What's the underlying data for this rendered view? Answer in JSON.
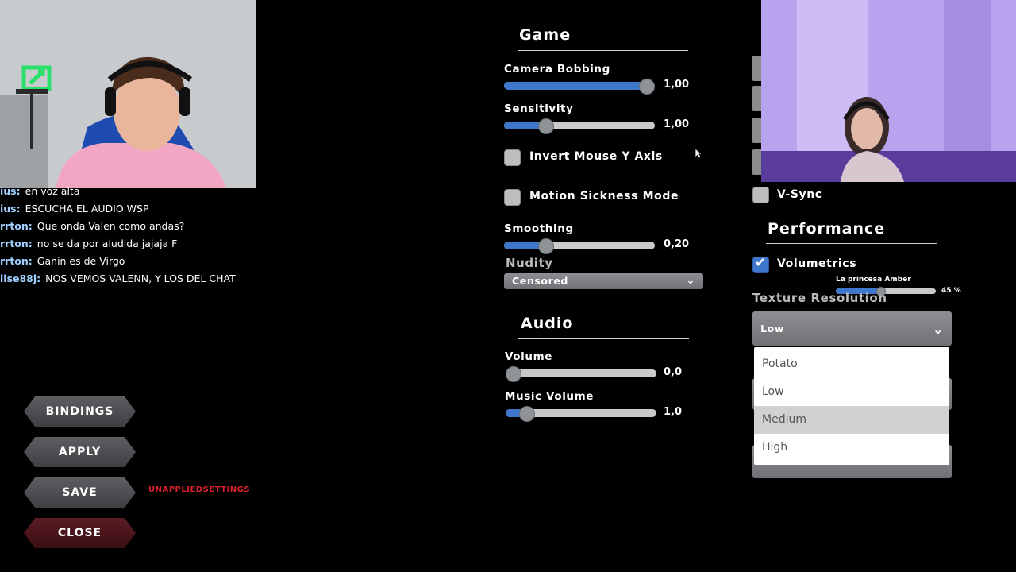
{
  "chat": [
    {
      "user": "ius:",
      "message": "en voz alta"
    },
    {
      "user": "ius:",
      "message": "ESCUCHA EL AUDIO WSP"
    },
    {
      "user": "rrton:",
      "message": "Que onda Valen como andas?"
    },
    {
      "user": "rrton:",
      "message": "no se da por aludida jajaja F"
    },
    {
      "user": "rrton:",
      "message": "Ganin es de Virgo"
    },
    {
      "user": "lise88j:",
      "message": "NOS VEMOS VALENN, Y LOS DEL CHAT"
    }
  ],
  "game": {
    "title": "Game",
    "camera_bobbing": {
      "label": "Camera Bobbing",
      "value_text": "1,00",
      "level": 1.0
    },
    "sensitivity": {
      "label": "Sensitivity",
      "value_text": "1,00",
      "level": 0.25
    },
    "invert_mouse": {
      "label": "Invert Mouse Y Axis",
      "checked": false
    },
    "motion_sickness": {
      "label": "Motion Sickness Mode",
      "checked": false
    },
    "smoothing": {
      "label": "Smoothing",
      "value_text": "0,20",
      "level": 0.25
    },
    "nudity": {
      "label": "Nudity",
      "selected": "Censored"
    }
  },
  "audio": {
    "title": "Audio",
    "volume": {
      "label": "Volume",
      "value_text": "0,0",
      "level": 0.0
    },
    "music_volume": {
      "label": "Music Volume",
      "value_text": "1,0",
      "level": 0.1
    }
  },
  "right": {
    "vsync": {
      "label": "V-Sync",
      "checked": false
    },
    "performance_title": "Performance",
    "volumetrics": {
      "label": "Volumetrics",
      "checked": true
    },
    "goal_overlay": {
      "label": "La princesa Amber",
      "percent_text": "45 %",
      "level": 0.45
    },
    "texture_resolution": {
      "label": "Texture Resolution",
      "selected": "Low",
      "options": [
        "Potato",
        "Low",
        "Medium",
        "High"
      ],
      "highlighted": "Medium"
    }
  },
  "buttons": {
    "bindings": "BINDINGS",
    "apply": "APPLY",
    "save": "SAVE",
    "close": "CLOSE"
  },
  "unapplied_text": "UNAPPLIEDSETTINGS",
  "colors": {
    "accent": "#3f77cc",
    "close_button": "#4a161c",
    "warning": "#d8202a"
  }
}
